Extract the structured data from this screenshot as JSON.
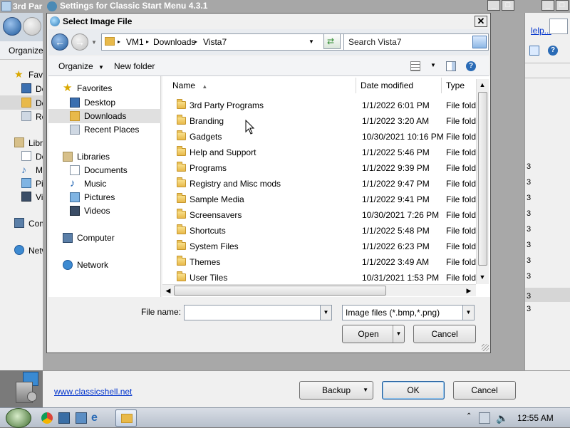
{
  "bg_explorer": {
    "title": "3rd Par",
    "toolbar_label": "Organize",
    "tree": [
      {
        "label": "Favo",
        "icon": "star-icon"
      },
      {
        "label": "De",
        "icon": "desktop-icon"
      },
      {
        "label": "Do",
        "icon": "downloads-icon"
      },
      {
        "label": "Re",
        "icon": "recent-places-icon"
      },
      {
        "label": "Libra",
        "icon": "libraries-icon"
      },
      {
        "label": "Do",
        "icon": "documents-icon"
      },
      {
        "label": "Mi",
        "icon": "music-icon"
      },
      {
        "label": "Pic",
        "icon": "pictures-icon"
      },
      {
        "label": "Vi",
        "icon": "videos-icon"
      },
      {
        "label": "Com",
        "icon": "computer-icon"
      },
      {
        "label": "Netw",
        "icon": "network-icon"
      }
    ]
  },
  "settings_window": {
    "title": "Settings for Classic Start Menu 4.3.1",
    "help_link": "lelp...",
    "website_link": "www.classicshell.net",
    "backup_label": "Backup",
    "ok_label": "OK",
    "cancel_label": "Cancel",
    "side_marks": [
      "3",
      "3",
      "3",
      "3",
      "3",
      "3",
      "3",
      "3",
      "3",
      "3"
    ]
  },
  "dialog": {
    "title": "Select Image File",
    "breadcrumb": [
      "VM1",
      "Downloads",
      "Vista7"
    ],
    "search_placeholder": "Search Vista7",
    "toolbar": {
      "organize": "Organize",
      "new_folder": "New folder"
    },
    "nav": {
      "favorites": "Favorites",
      "desktop": "Desktop",
      "downloads": "Downloads",
      "recent_places": "Recent Places",
      "libraries": "Libraries",
      "documents": "Documents",
      "music": "Music",
      "pictures": "Pictures",
      "videos": "Videos",
      "computer": "Computer",
      "network": "Network"
    },
    "columns": {
      "name": "Name",
      "date": "Date modified",
      "type": "Type"
    },
    "files": [
      {
        "name": "3rd Party Programs",
        "date": "1/1/2022 6:01 PM",
        "type": "File folder"
      },
      {
        "name": "Branding",
        "date": "1/1/2022 3:20 AM",
        "type": "File folder"
      },
      {
        "name": "Gadgets",
        "date": "10/30/2021 10:16 PM",
        "type": "File folder"
      },
      {
        "name": "Help and Support",
        "date": "1/1/2022 5:46 PM",
        "type": "File folder"
      },
      {
        "name": "Programs",
        "date": "1/1/2022 9:39 PM",
        "type": "File folder"
      },
      {
        "name": "Registry and Misc mods",
        "date": "1/1/2022 9:47 PM",
        "type": "File folder"
      },
      {
        "name": "Sample Media",
        "date": "1/1/2022 9:41 PM",
        "type": "File folder"
      },
      {
        "name": "Screensavers",
        "date": "10/30/2021 7:26 PM",
        "type": "File folder"
      },
      {
        "name": "Shortcuts",
        "date": "1/1/2022 5:48 PM",
        "type": "File folder"
      },
      {
        "name": "System Files",
        "date": "1/1/2022 6:23 PM",
        "type": "File folder"
      },
      {
        "name": "Themes",
        "date": "1/1/2022 3:49 AM",
        "type": "File folder"
      },
      {
        "name": "User Tiles",
        "date": "10/31/2021 1:53 PM",
        "type": "File folder"
      }
    ],
    "file_name_label": "File name:",
    "file_name_value": "",
    "file_type_filter": "Image files (*.bmp,*.png)",
    "open_label": "Open",
    "cancel_label": "Cancel"
  },
  "taskbar": {
    "clock": "12:55 AM"
  },
  "colors": {
    "link": "#0033cc",
    "accent": "#1f5a9c",
    "folder": "#e8b94a"
  }
}
